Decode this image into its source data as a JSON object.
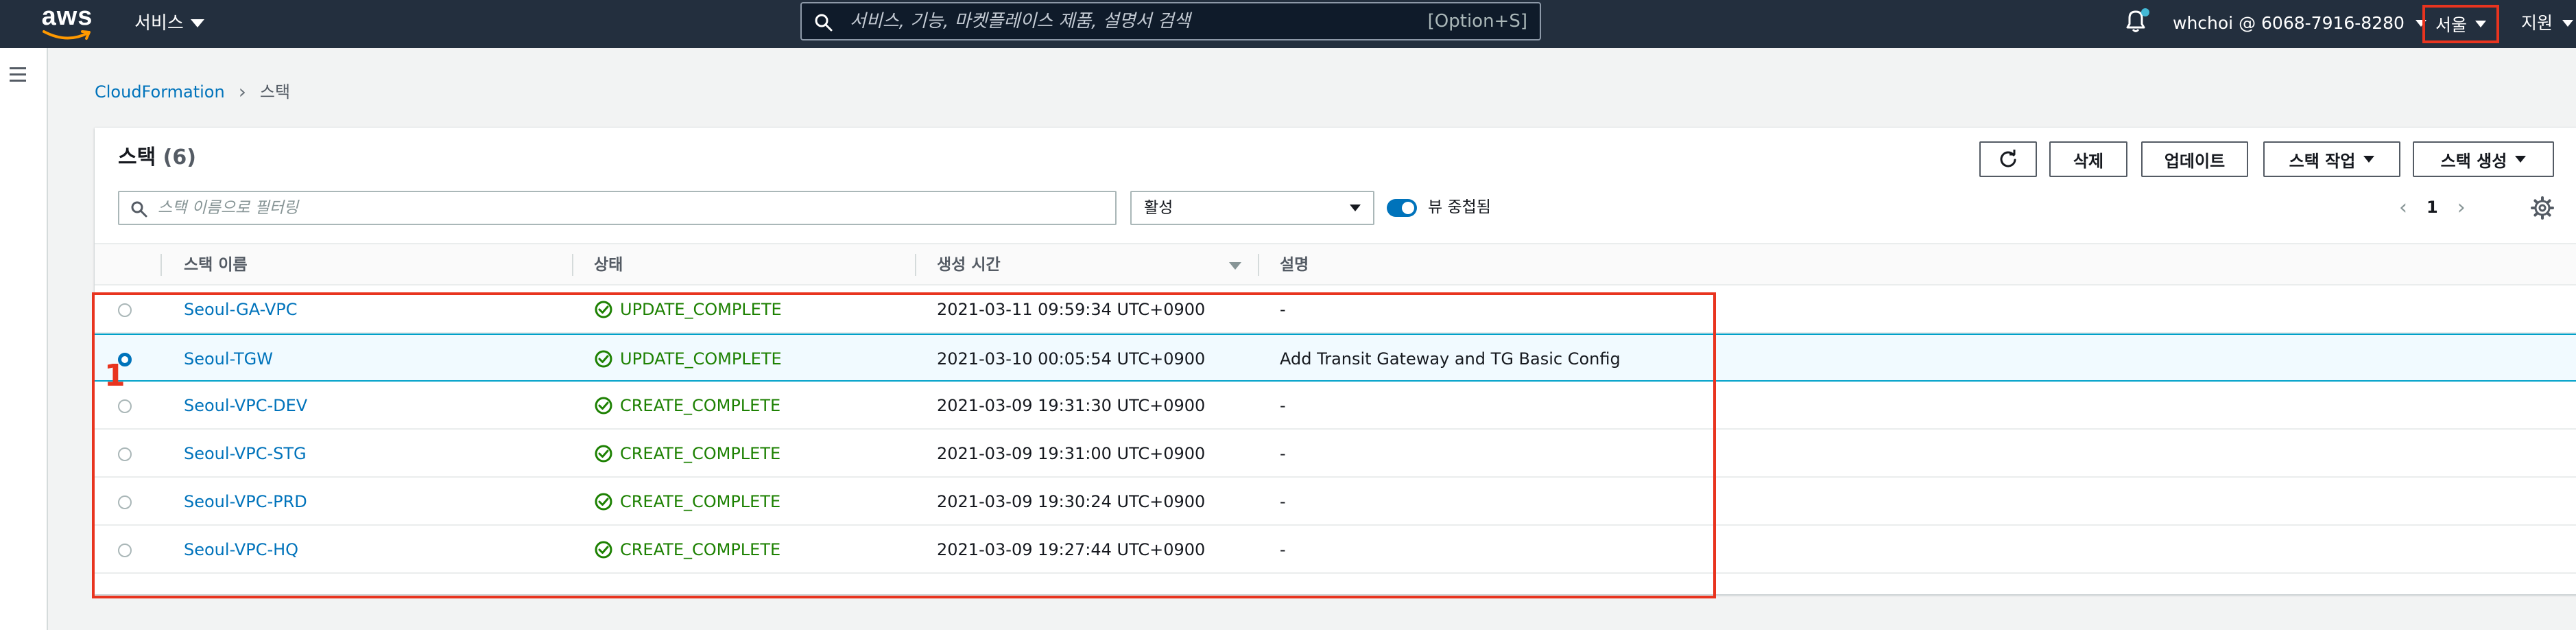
{
  "topnav": {
    "logo_text": "aws",
    "services_label": "서비스",
    "search_placeholder": "서비스, 기능, 마켓플레이스 제품, 설명서 검색",
    "search_shortcut": "[Option+S]",
    "account": "whchoi @ 6068-7916-8280",
    "region": "서울",
    "support": "지원"
  },
  "breadcrumb": {
    "root": "CloudFormation",
    "current": "스택"
  },
  "panel": {
    "title": "스택",
    "count": "(6)",
    "buttons": {
      "delete": "삭제",
      "update": "업데이트",
      "stack_actions": "스택 작업",
      "create_stack": "스택 생성"
    },
    "filter_placeholder": "스택 이름으로 필터링",
    "status_filter": "활성",
    "nested_toggle_label": "뷰 중첩됨",
    "page": "1"
  },
  "table": {
    "columns": [
      "스택 이름",
      "상태",
      "생성 시간",
      "설명"
    ],
    "rows": [
      {
        "name": "Seoul-GA-VPC",
        "status": "UPDATE_COMPLETE",
        "time": "2021-03-11 09:59:34 UTC+0900",
        "desc": "-"
      },
      {
        "name": "Seoul-TGW",
        "status": "UPDATE_COMPLETE",
        "time": "2021-03-10 00:05:54 UTC+0900",
        "desc": "Add Transit Gateway and TG Basic Config"
      },
      {
        "name": "Seoul-VPC-DEV",
        "status": "CREATE_COMPLETE",
        "time": "2021-03-09 19:31:30 UTC+0900",
        "desc": "-"
      },
      {
        "name": "Seoul-VPC-STG",
        "status": "CREATE_COMPLETE",
        "time": "2021-03-09 19:31:00 UTC+0900",
        "desc": "-"
      },
      {
        "name": "Seoul-VPC-PRD",
        "status": "CREATE_COMPLETE",
        "time": "2021-03-09 19:30:24 UTC+0900",
        "desc": "-"
      },
      {
        "name": "Seoul-VPC-HQ",
        "status": "CREATE_COMPLETE",
        "time": "2021-03-09 19:27:44 UTC+0900",
        "desc": "-"
      }
    ]
  },
  "annotation": {
    "number": "1"
  },
  "colors": {
    "nav_bg": "#232f3e",
    "link": "#0073bb",
    "success": "#1d8102",
    "annotation": "#e8341f",
    "selected_row": "#f1faff"
  }
}
